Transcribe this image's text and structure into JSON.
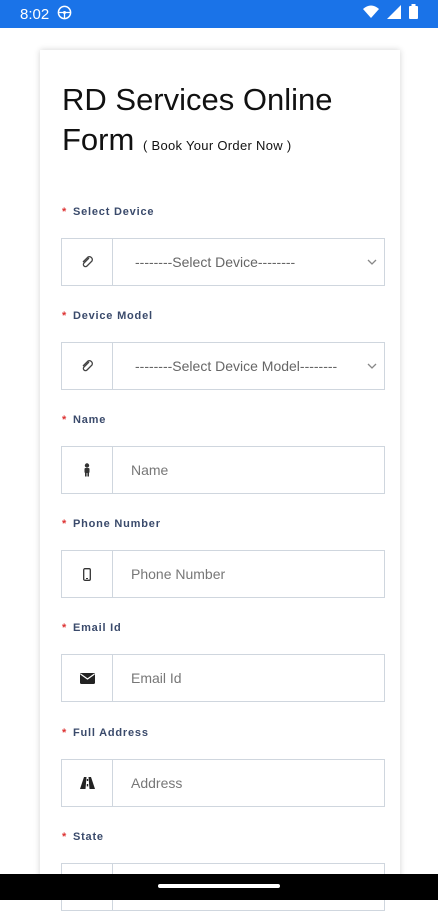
{
  "status_bar": {
    "time": "8:02",
    "left_icon": "steering-wheel-icon",
    "right_icons": [
      "wifi-icon",
      "cellular-signal-icon",
      "battery-icon"
    ]
  },
  "form": {
    "title": "RD Services Online Form",
    "subtitle": "( Book Your Order Now )",
    "fields": [
      {
        "label": "Select Device",
        "required_mark": "*",
        "type": "select",
        "value": "--------Select Device--------",
        "icon": "paperclip-icon"
      },
      {
        "label": "Device Model",
        "required_mark": "*",
        "type": "select",
        "value": "--------Select Device Model--------",
        "icon": "paperclip-icon"
      },
      {
        "label": "Name",
        "required_mark": "*",
        "type": "input",
        "placeholder": "Name",
        "icon": "person-icon"
      },
      {
        "label": "Phone Number",
        "required_mark": "*",
        "type": "input",
        "placeholder": "Phone Number",
        "icon": "mobile-phone-icon"
      },
      {
        "label": "Email Id",
        "required_mark": "*",
        "type": "input",
        "placeholder": "Email Id",
        "icon": "envelope-icon"
      },
      {
        "label": "Full Address",
        "required_mark": "*",
        "type": "input",
        "placeholder": "Address",
        "icon": "road-icon"
      },
      {
        "label": "State",
        "required_mark": "*",
        "type": "select",
        "value": "",
        "icon": ""
      }
    ]
  },
  "colors": {
    "status_bar": "#1a73e8",
    "required": "#dd3333",
    "label": "#3a4a6b",
    "border": "#cfd6de"
  }
}
